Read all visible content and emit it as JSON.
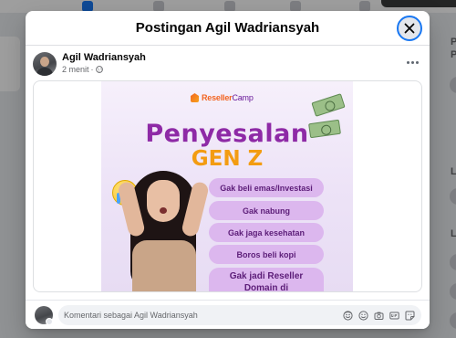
{
  "modal": {
    "title": "Postingan Agil Wadriansyah"
  },
  "post": {
    "author": "Agil Wadriansyah",
    "time": "2 menit",
    "separator": "·",
    "image": {
      "brand_primary": "Reseller",
      "brand_secondary": "Camp",
      "headline_line1": "Penyesalan",
      "headline_line2": "GEN Z",
      "items": [
        "Gak beli emas/Investasi",
        "Gak nabung",
        "Gak jaga kesehatan",
        "Boros beli kopi"
      ],
      "last_item_line1": "Gak jadi Reseller",
      "last_item_line2": "Domain di"
    }
  },
  "composer": {
    "placeholder": "Komentari sebagai Agil Wadriansyah",
    "icons": [
      "avatar-sticker-icon",
      "emoji-icon",
      "camera-icon",
      "gif-icon",
      "sticker-icon"
    ]
  },
  "background_page": {
    "side_texts": [
      "P",
      "P",
      "L",
      "L"
    ]
  },
  "colors": {
    "accent": "#1877f2",
    "headline_purple": "#8e2aa6",
    "headline_orange": "#f39c12",
    "brand_orange": "#f26522",
    "pill": "#dcb7ee"
  }
}
